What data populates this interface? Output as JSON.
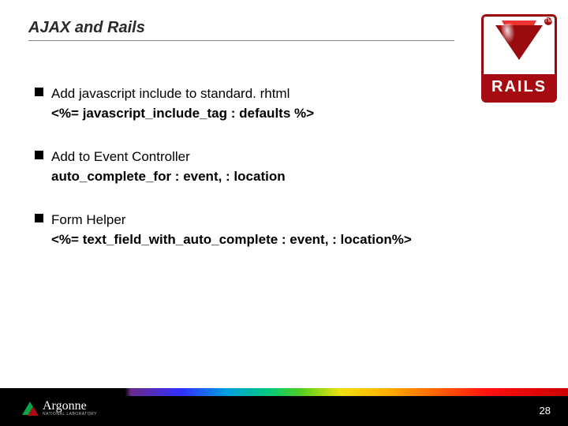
{
  "slide": {
    "title": "AJAX and Rails",
    "items": [
      {
        "heading": "Add javascript include to standard. rhtml",
        "code": "<%= javascript_include_tag : defaults %>"
      },
      {
        "heading": "Add to Event Controller",
        "code": "auto_complete_for : event, : location"
      },
      {
        "heading": "Form Helper",
        "code": "<%= text_field_with_auto_complete : event, : location%>"
      }
    ]
  },
  "logo": {
    "text": "RAILS",
    "tm": "TM"
  },
  "footer": {
    "lab_name": "Argonne",
    "lab_sub": "NATIONAL LABORATORY",
    "page_number": "28"
  }
}
